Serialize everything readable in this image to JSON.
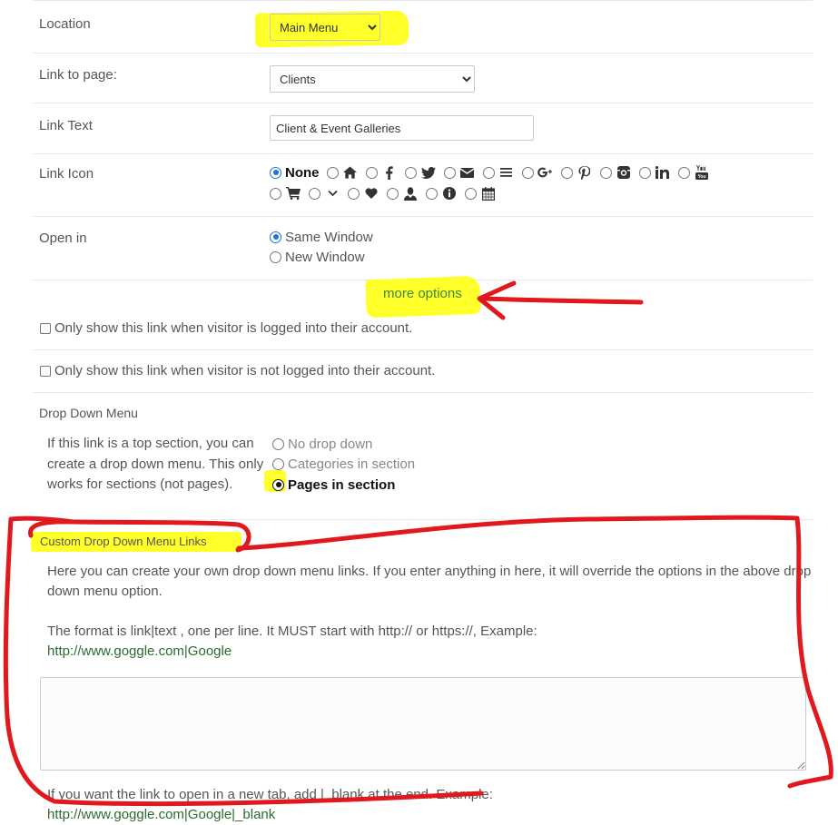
{
  "location": {
    "label": "Location",
    "value": "Main Menu"
  },
  "link_to_page": {
    "label": "Link to page:",
    "value": "Clients"
  },
  "link_text": {
    "label": "Link Text",
    "value": "Client & Event Galleries"
  },
  "link_icon": {
    "label": "Link Icon",
    "none_label": "None"
  },
  "open_in": {
    "label": "Open in",
    "options": [
      "Same Window",
      "New Window"
    ],
    "selected": "Same Window"
  },
  "more_options": "more options",
  "checks": [
    "Only show this link when visitor is logged into their account.",
    "Only show this link when visitor is not logged into their account."
  ],
  "dropdown": {
    "title": "Drop Down Menu",
    "desc": [
      "If this link is a top section, you can",
      "create a drop down menu. This only",
      "works for sections (not pages)."
    ],
    "options": [
      "No drop down",
      "Categories in section",
      "Pages in section"
    ],
    "selected": "Pages in section"
  },
  "custom": {
    "title": "Custom Drop Down Menu Links",
    "p1a": "Here you can create your own drop down menu links. If you enter anything in here, it will override the options in the above drop",
    "p1b": "down menu option.",
    "p2a": "The format is link|text , one per line. It MUST start with http:// or https://, Example:",
    "p2b": "http://www.goggle.com|Google",
    "p3a": "If you want the link to open in a new tab, add |_blank at the end. Example:",
    "p3b": "http://www.goggle.com|Google|_blank"
  },
  "annotation_colors": {
    "highlight": "#ffff2a",
    "marker": "#e0191f"
  }
}
